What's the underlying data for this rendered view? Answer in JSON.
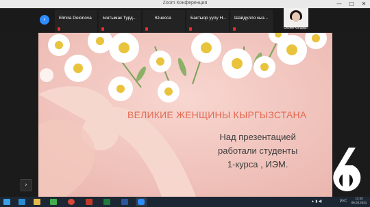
{
  "window": {
    "title": "Zoom Конференция",
    "minimize": "—",
    "maximize": "□",
    "close": "✕"
  },
  "participants": [
    {
      "name": "Elmira Doionova"
    },
    {
      "name": "Ынтымак Турд..."
    },
    {
      "name": "Юнесса"
    },
    {
      "name": "Бактыяр  уулу Н..."
    },
    {
      "name": "Шайдулло  кыз..."
    }
  ],
  "self_view": {
    "name": "Сезим Калдар..."
  },
  "nav": {
    "prev": "‹",
    "side": "›"
  },
  "slide": {
    "heading": "ВЕЛИКИЕ ЖЕНЩИНЫ КЫРГЫЗСТАНА",
    "body_lines": [
      "Над презентацией",
      "работали студенты",
      "1-курса , ИЭМ."
    ]
  },
  "taskbar": {
    "apps": [
      {
        "icon": "start-icon",
        "color": "#3aa0e8"
      },
      {
        "icon": "ie-icon",
        "color": "#2b8ad6"
      },
      {
        "icon": "explorer-icon",
        "color": "#e7b84a"
      },
      {
        "icon": "media-icon",
        "color": "#3fae4f"
      },
      {
        "icon": "chrome-icon",
        "color": "#d9473b"
      },
      {
        "icon": "presentation-icon",
        "color": "#c0392b"
      },
      {
        "icon": "excel-icon",
        "color": "#1f7a3e"
      },
      {
        "icon": "word-icon",
        "color": "#2b579a"
      },
      {
        "icon": "zoom-icon",
        "color": "#2d8cff"
      }
    ],
    "tray_lang": "РУС",
    "time": "11:42",
    "date": "06.03.2021"
  },
  "colors": {
    "accent": "#2d8cff",
    "slide_bg": "#f3c9c2",
    "heading": "#e26b53"
  }
}
